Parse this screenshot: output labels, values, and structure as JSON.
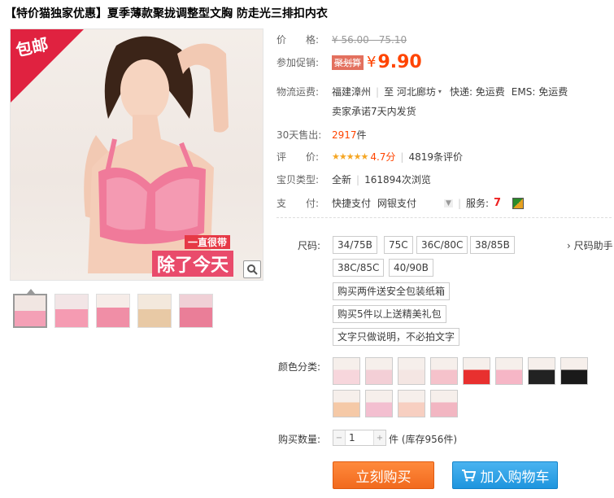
{
  "title": "【特价猫独家优惠】夏季薄款聚拢调整型文胸 防走光三排扣内衣",
  "image": {
    "badge": "包邮",
    "promo_line1": "一直很带",
    "promo_line2": "除了今天"
  },
  "price": {
    "label": "价　　格:",
    "original": "¥ 56.00 - 75.10",
    "promo_label": "参加促销:",
    "promo_tag": "聚划算",
    "currency": "¥",
    "promo_price": "9.90"
  },
  "shipping": {
    "label": "物流运费:",
    "from": "福建漳州",
    "to_prefix": "至",
    "to": "河北廊坊",
    "express": "快递: 免运费",
    "ems": "EMS: 免运费",
    "promise": "卖家承诺7天内发货"
  },
  "sales": {
    "label": "30天售出:",
    "count": "2917",
    "unit": "件"
  },
  "rating": {
    "label": "评　　价:",
    "stars": "★★★★★",
    "score": "4.7分",
    "reviews": "4819条评价"
  },
  "type": {
    "label": "宝贝类型:",
    "value": "全新",
    "views": "161894次浏览"
  },
  "payment": {
    "label": "支　　付:",
    "method1": "快捷支付",
    "method2": "网银支付",
    "service_label": "服务:",
    "service_badge": "7"
  },
  "size": {
    "label": "尺码:",
    "helper": "尺码助手",
    "options": [
      "34/75B",
      "75C",
      "36C/80C",
      "38/85B",
      "38C/85C",
      "40/90B"
    ],
    "notes": [
      "购买两件送安全包装纸箱",
      "购买5件以上送精美礼包",
      "文字只做说明，不必拍文字"
    ]
  },
  "color": {
    "label": "颜色分类:",
    "count": 12,
    "swatch_colors": [
      "#f7d6dc",
      "#f3cfd6",
      "#f4e6e3",
      "#f5c2cb",
      "#e8302f",
      "#f6b6c6",
      "#222222",
      "#1a1a1a",
      "#f5c9a7",
      "#f3bfd0",
      "#f7cfc1",
      "#f2b6c2"
    ]
  },
  "quantity": {
    "label": "购买数量:",
    "value": "1",
    "unit": "件",
    "stock": "(库存956件)"
  },
  "actions": {
    "buy": "立刻购买",
    "cart": "加入购物车"
  },
  "colors": {
    "accent": "#ff4400",
    "buy": "#f16a1e",
    "cart": "#1e95de"
  }
}
